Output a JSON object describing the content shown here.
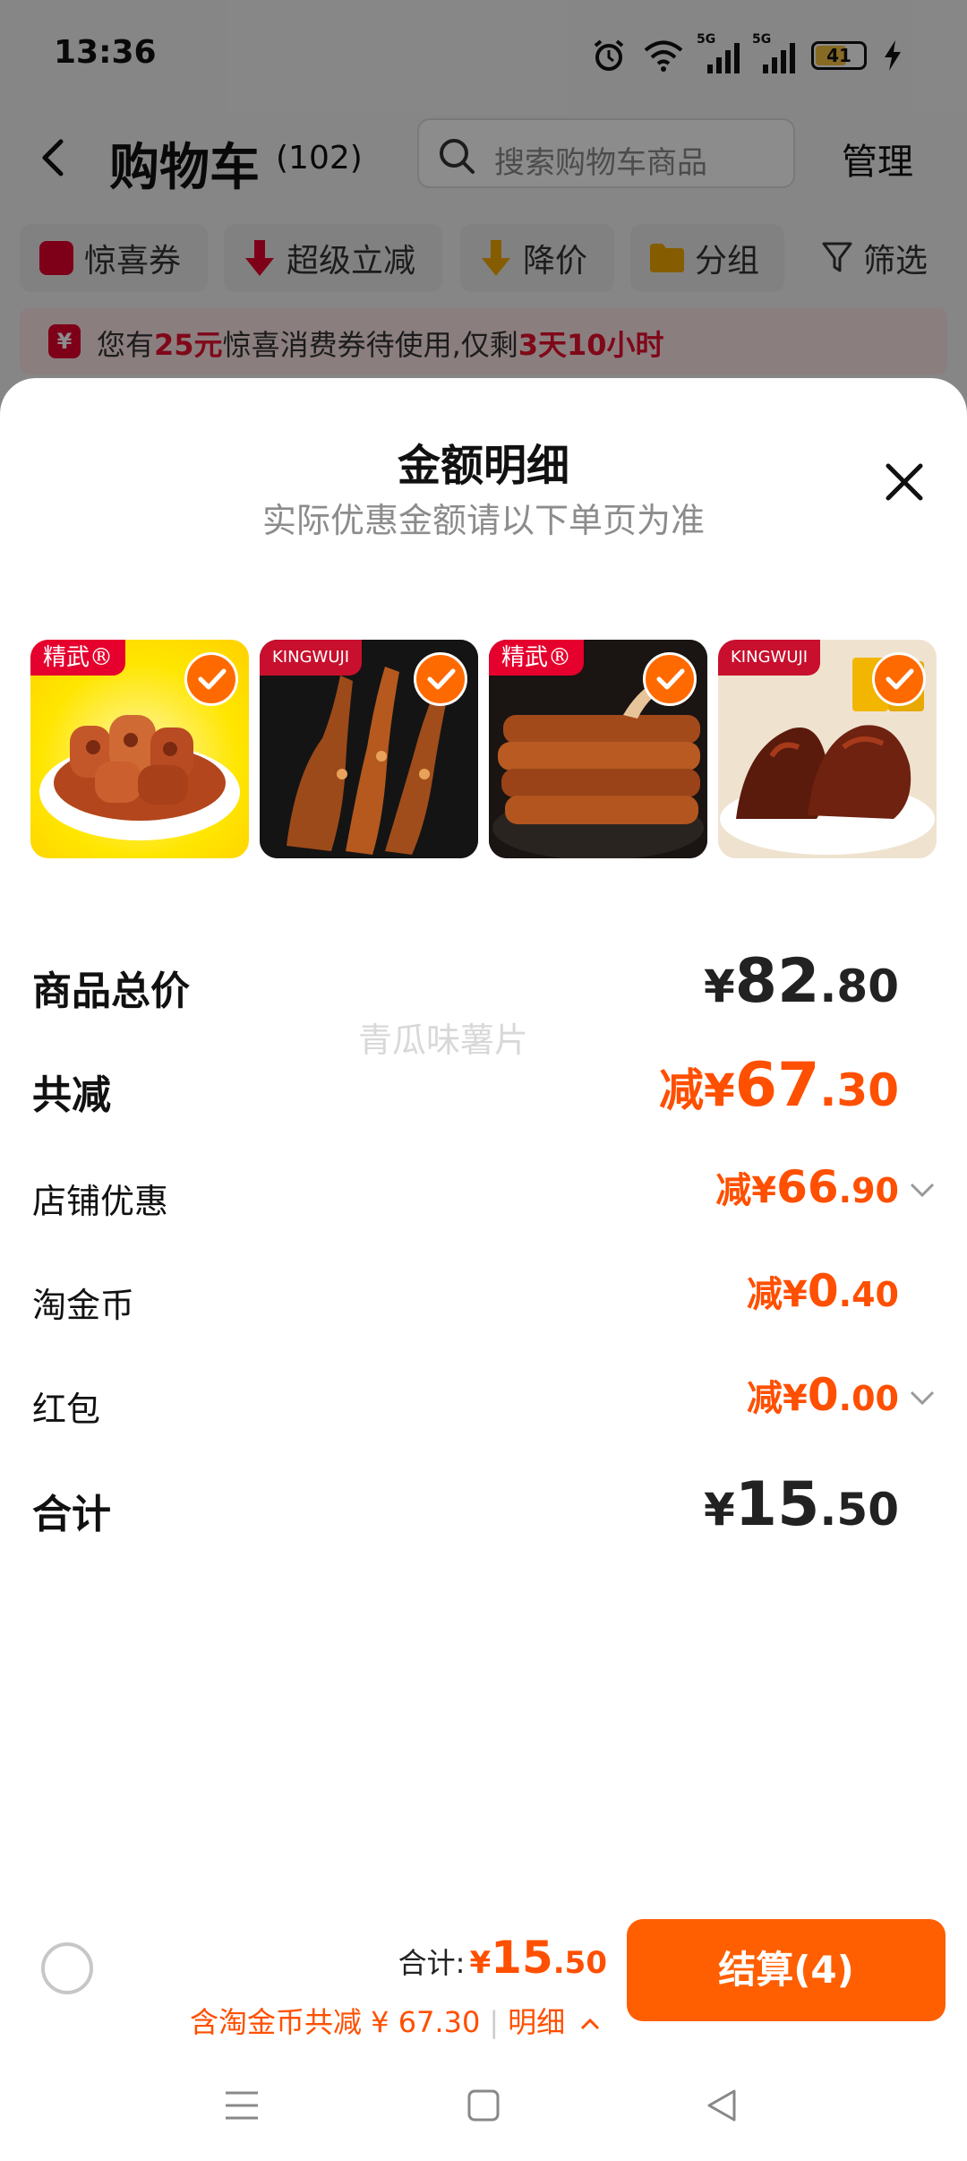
{
  "status_bar": {
    "time": "13:36",
    "battery": "41",
    "net_5g_1": "5G",
    "net_5g_2": "5G"
  },
  "nav": {
    "title": "购物车",
    "count": "(102)",
    "search_placeholder": "搜索购物车商品",
    "manage": "管理"
  },
  "filters": [
    {
      "label": "惊喜券",
      "icon": "coupon-icon"
    },
    {
      "label": "超级立减",
      "icon": "down-arrow-icon"
    },
    {
      "label": "降价",
      "icon": "price-drop-icon"
    },
    {
      "label": "分组",
      "icon": "folder-icon"
    },
    {
      "label": "筛选",
      "icon": "filter-icon"
    }
  ],
  "notice": {
    "prefix": "您有",
    "amount": "25元",
    "middle": "惊喜消费券待使用,仅剩",
    "time": "3天10小时"
  },
  "sheet": {
    "title": "金额明细",
    "subtitle": "实际优惠金额请以下单页为准",
    "products": [
      {
        "brand": "精武®",
        "brand_color": "#e5002d",
        "checked": true
      },
      {
        "brand": "KINGWUJI",
        "brand_color": "#c8102e",
        "checked": true
      },
      {
        "brand": "精武®",
        "brand_color": "#e5002d",
        "checked": true
      },
      {
        "brand": "KINGWUJI",
        "brand_color": "#c8102e",
        "checked": true
      }
    ],
    "watermark": "青瓜味薯片",
    "rows": {
      "goods_total": {
        "label": "商品总价",
        "symbol": "¥",
        "int": "82",
        "dec": ".80"
      },
      "total_discount": {
        "label": "共减",
        "symbol": "减¥",
        "int": "67",
        "dec": ".30"
      },
      "store_discount": {
        "label": "店铺优惠",
        "symbol": "减¥",
        "int": "66",
        "dec": ".90"
      },
      "tao_coins": {
        "label": "淘金币",
        "symbol": "减¥",
        "int": "0",
        "dec": ".40"
      },
      "red_packet": {
        "label": "红包",
        "symbol": "减¥",
        "int": "0",
        "dec": ".00"
      },
      "sum": {
        "label": "合计",
        "symbol": "¥",
        "int": "15",
        "dec": ".50"
      }
    }
  },
  "bottom_bar": {
    "total_label": "合计:",
    "total_symbol": "¥",
    "total_int": "15",
    "total_dec": ".50",
    "saving_text": "含淘金币共减 ¥ 67.30",
    "detail_label": "明细",
    "checkout_label": "结算(4)"
  },
  "colors": {
    "accent": "#ff5f00",
    "discount": "#ff4f00",
    "notice_bg": "#fde6e8",
    "notice_highlight": "#e8102e"
  }
}
